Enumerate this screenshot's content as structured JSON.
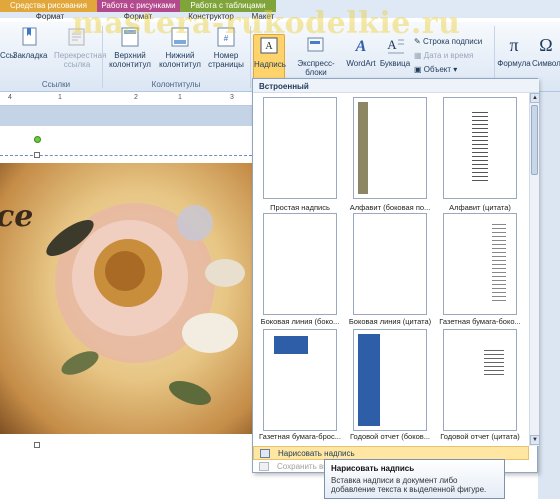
{
  "watermark": "mastera-rukodelkie.ru",
  "context_tabs": {
    "drawing": "Средства рисования",
    "pictures": "Работа с рисунками",
    "tables": "Работа с таблицами"
  },
  "sub_tabs": {
    "format1": "Формат",
    "format2": "Формат",
    "constructor": "Конструктор",
    "layout": "Макет"
  },
  "ribbon": {
    "link": "Ссылка",
    "bookmark": "Закладка",
    "crossref": "Перекрестная ссылка",
    "header": "Верхний колонтитул",
    "footer": "Нижний колонтитул",
    "page_number": "Номер страницы",
    "textbox": "Надпись",
    "express": "Экспресс-блоки",
    "wordart": "WordArt",
    "dropcap": "Буквица",
    "signature": "Строка подписи",
    "datetime": "Дата и время",
    "object": "Объект",
    "formula": "Формула",
    "symbols": "Символ",
    "group_links": "Ссылки",
    "group_headers": "Колонтитулы"
  },
  "ruler_ticks": [
    "4",
    "1",
    "2",
    "1",
    "3"
  ],
  "gallery": {
    "header": "Встроенный",
    "items": [
      "Простая надпись",
      "Алфавит (боковая по...",
      "Алфавит (цитата)",
      "Боковая линия (боко...",
      "Боковая линия (цитата)",
      "Газетная бумага-боко...",
      "Газетная бумага-брос...",
      "Годовой отчет (боков...",
      "Годовой отчет (цитата)"
    ],
    "draw_textbox": "Нарисовать надпись",
    "save_selection": "Сохранить выделенный фрагмент в коллекцию надписей"
  },
  "tooltip": {
    "title": "Нарисовать надпись",
    "body": "Вставка надписи в документ либо добавление текста к выделенной фигуре."
  },
  "photo_text": "ce"
}
